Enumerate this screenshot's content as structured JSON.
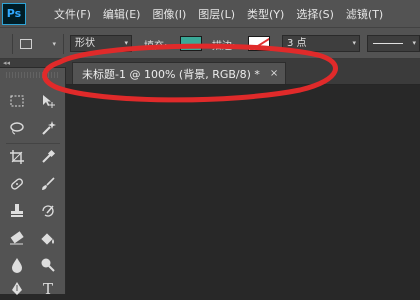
{
  "app": {
    "logo_text": "Ps"
  },
  "menu": {
    "items": [
      "文件(F)",
      "编辑(E)",
      "图像(I)",
      "图层(L)",
      "类型(Y)",
      "选择(S)",
      "滤镜(T)"
    ]
  },
  "options_bar": {
    "mode_value": "形状",
    "fill_label": "填充:",
    "stroke_label": "描边:",
    "stroke_width_value": "3 点",
    "fill_color": "#3aa897",
    "stroke_color": "#ffffff"
  },
  "toolbar_strip": {
    "collapse_glyph": "◂◂"
  },
  "document_tab": {
    "title": "未标题-1 @ 100% (背景, RGB/8) *",
    "close_glyph": "×"
  },
  "annotation": {
    "color": "#e02a2a"
  },
  "tools": [
    "marquee-icon",
    "move-icon",
    "lasso-icon",
    "magic-wand-icon",
    "crop-icon",
    "eyedropper-icon",
    "healing-brush-icon",
    "brush-icon",
    "clone-stamp-icon",
    "history-brush-icon",
    "eraser-icon",
    "paint-bucket-icon",
    "blur-icon",
    "dodge-icon",
    "pen-icon",
    "type-icon"
  ],
  "tool_glyphs": {
    "type": "T"
  }
}
